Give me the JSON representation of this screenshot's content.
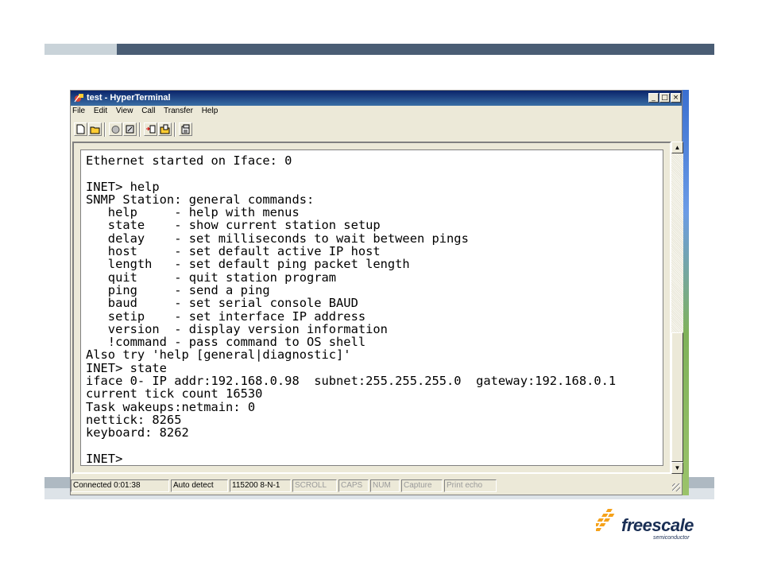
{
  "window": {
    "title": "test - HyperTerminal",
    "controls": [
      "_",
      "□",
      "×"
    ]
  },
  "menu": [
    "File",
    "Edit",
    "View",
    "Call",
    "Transfer",
    "Help"
  ],
  "toolbar_icons": [
    "new-icon",
    "open-icon",
    "disconnect-icon",
    "connect-icon",
    "send-icon",
    "receive-icon",
    "properties-icon"
  ],
  "terminal": {
    "lines": [
      "Ethernet started on Iface: 0",
      "",
      "INET> help",
      "SNMP Station: general commands:",
      "   help     - help with menus",
      "   state    - show current station setup",
      "   delay    - set milliseconds to wait between pings",
      "   host     - set default active IP host",
      "   length   - set default ping packet length",
      "   quit     - quit station program",
      "   ping     - send a ping",
      "   baud     - set serial console BAUD",
      "   setip    - set interface IP address",
      "   version  - display version information",
      "   !command - pass command to OS shell",
      "Also try 'help [general|diagnostic]'",
      "INET> state",
      "iface 0- IP addr:192.168.0.98  subnet:255.255.255.0  gateway:192.168.0.1",
      "current tick count 16530",
      "Task wakeups:netmain: 0",
      "nettick: 8265",
      "keyboard: 8262",
      "",
      "INET>"
    ]
  },
  "status": {
    "connected": "Connected 0:01:38",
    "detect": "Auto detect",
    "port": "115200 8-N-1",
    "scroll": "SCROLL",
    "caps": "CAPS",
    "num": "NUM",
    "capture": "Capture",
    "print_echo": "Print echo"
  },
  "logo": {
    "name": "freescale",
    "tagline": "semiconductor"
  }
}
